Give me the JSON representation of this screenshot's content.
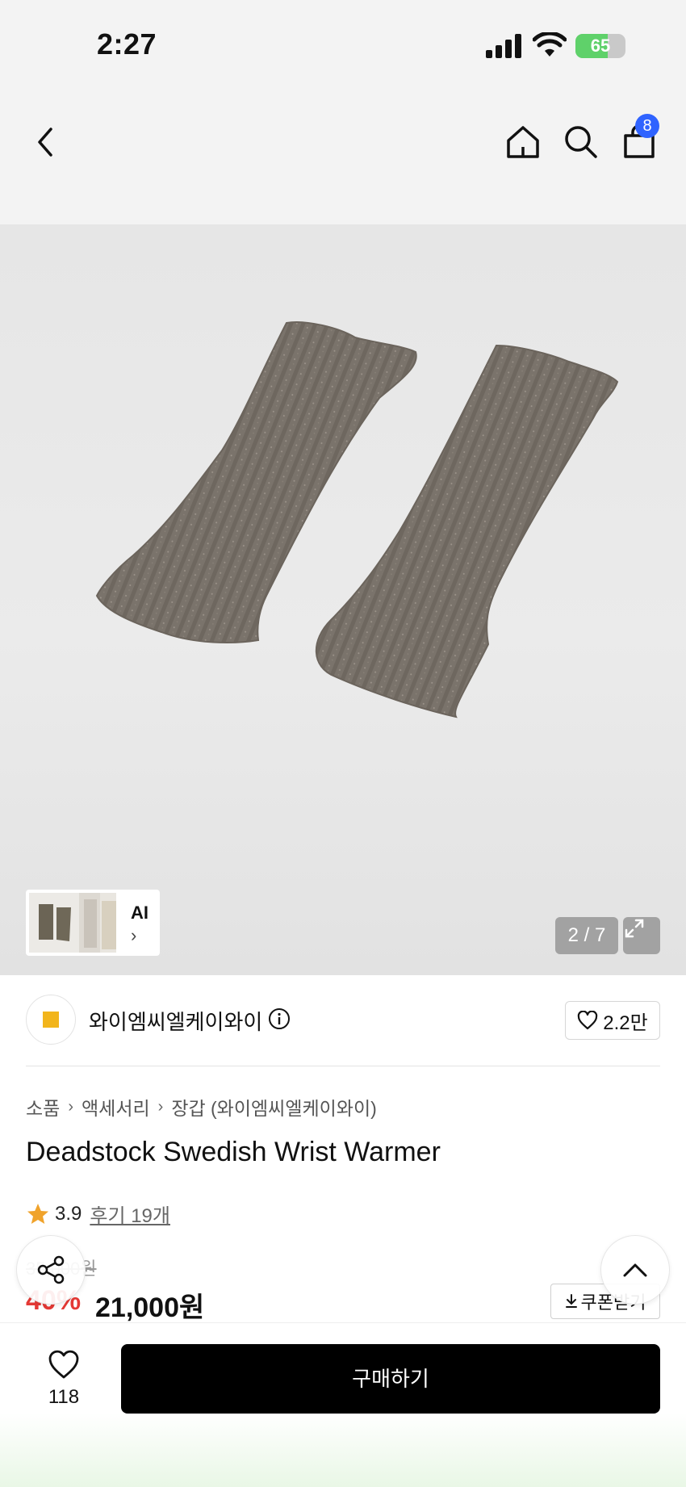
{
  "status_bar": {
    "time": "2:27",
    "battery": "65",
    "battery_level": 0.65
  },
  "nav": {
    "back": "back-icon",
    "home": "home-icon",
    "search": "search-icon",
    "bag": "shopping-bag-icon",
    "bag_badge": "8"
  },
  "gallery": {
    "ai_label": "AI",
    "counter": "2 / 7"
  },
  "brand": {
    "name": "와이엠씨엘케이와이",
    "likes": "2.2만"
  },
  "breadcrumb": [
    "소품",
    "액세서리",
    "장갑 (와이엠씨엘케이와이)"
  ],
  "product": {
    "title": "Deadstock Swedish Wrist Warmer",
    "rating": "3.9",
    "review": "후기 19개",
    "original_price": "35,000원",
    "discount": "40%",
    "price": "21,000원",
    "coupon": "쿠폰받기"
  },
  "bottom": {
    "wishlist_count": "118",
    "buy_label": "구매하기"
  },
  "colors": {
    "accent": "#2f63ff",
    "discount": "#e53935",
    "star": "#f0a32b"
  }
}
